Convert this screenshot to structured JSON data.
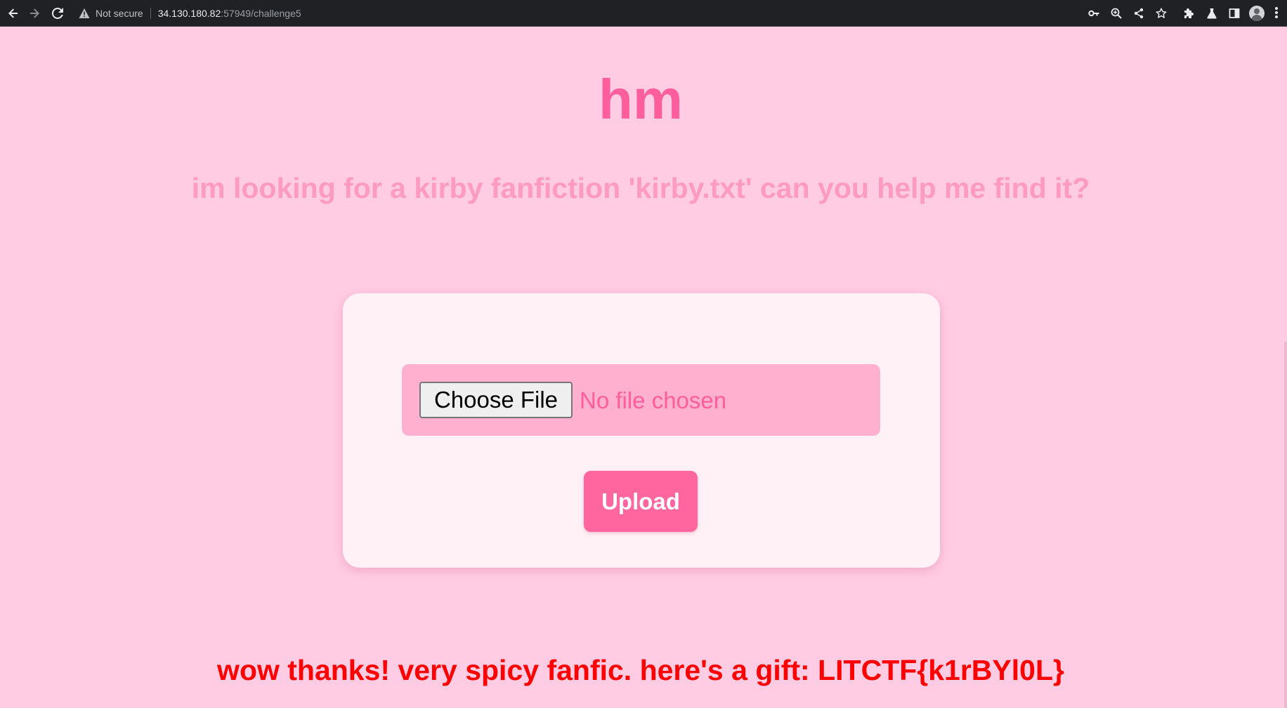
{
  "browser": {
    "security_label": "Not secure",
    "url_host": "34.130.180.82",
    "url_rest": ":57949/challenge5"
  },
  "page": {
    "title": "hm",
    "subtitle": "im looking for a kirby fanfiction 'kirby.txt' can you help me find it?",
    "file_input": {
      "button_label": "Choose File",
      "status": "No file chosen"
    },
    "upload_label": "Upload",
    "result_message": "wow thanks! very spicy fanfic. here's a gift: LITCTF{k1rBYl0L}"
  },
  "colors": {
    "background": "#ffcce3",
    "title": "#ff5e9c",
    "subtitle": "#ff9ac2",
    "card": "#fff1f6",
    "file_box": "#ffb0cf",
    "upload_button": "#ff659f",
    "result_text": "#ff0000"
  },
  "icons": {
    "toolbar": [
      "back-icon",
      "forward-icon",
      "reload-icon",
      "warning-icon",
      "key-icon",
      "zoom-icon",
      "share-icon",
      "star-icon",
      "extensions-icon",
      "labs-icon",
      "side-panel-icon",
      "profile-icon",
      "menu-icon"
    ]
  }
}
